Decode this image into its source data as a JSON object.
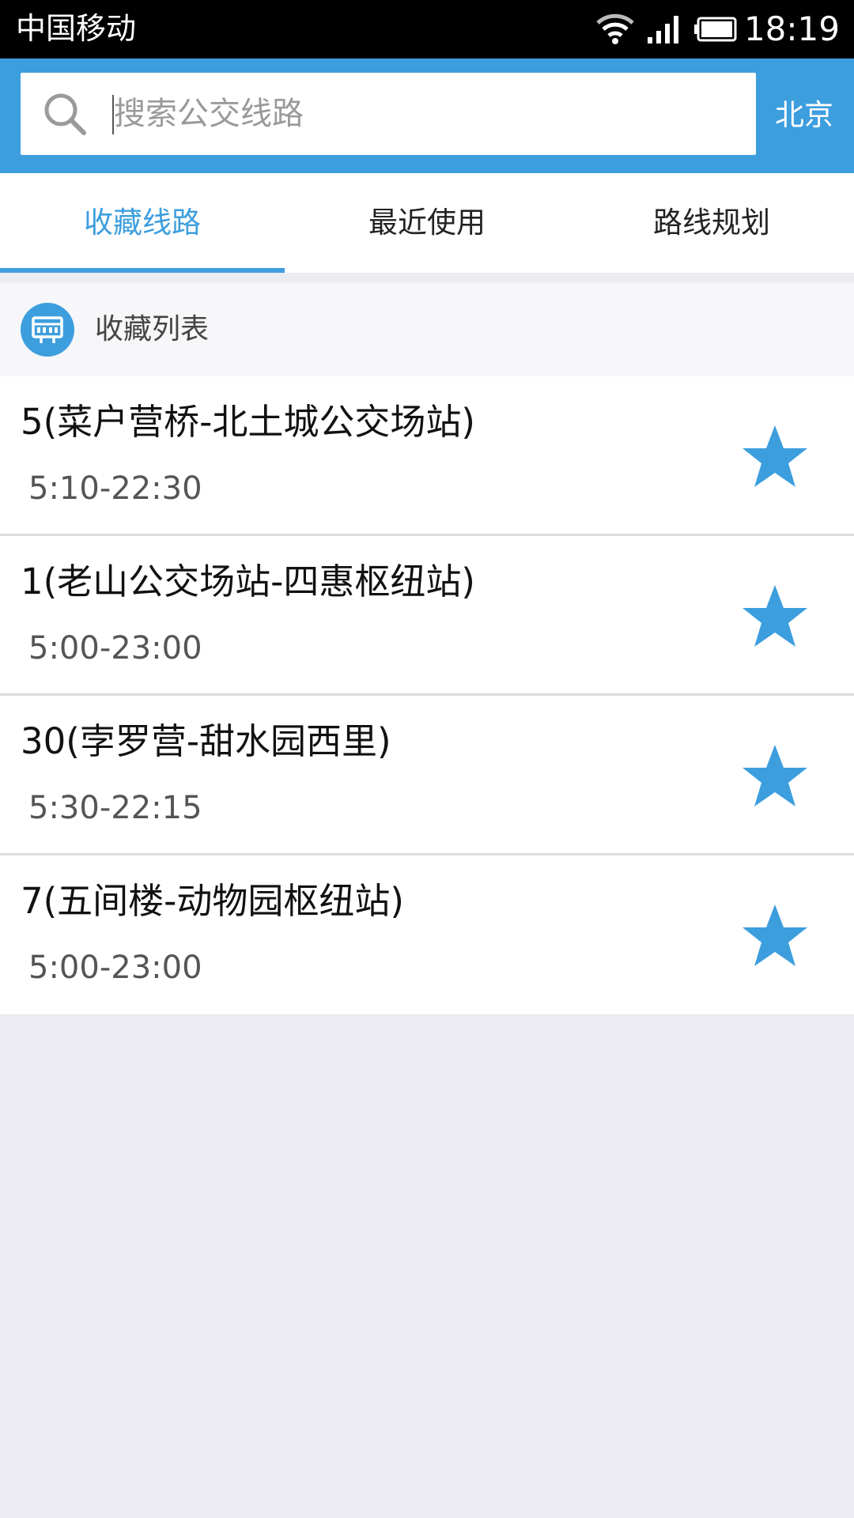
{
  "status_bar": {
    "carrier": "中国移动",
    "time": "18:19"
  },
  "header": {
    "search_placeholder": "搜索公交线路",
    "city": "北京",
    "accent_color": "#3d9ede"
  },
  "tabs": [
    {
      "label": "收藏线路",
      "active": true
    },
    {
      "label": "最近使用",
      "active": false
    },
    {
      "label": "路线规划",
      "active": false
    }
  ],
  "section": {
    "title": "收藏列表",
    "icon": "bus-stop-icon"
  },
  "routes": [
    {
      "name": "5(菜户营桥-北土城公交场站)",
      "hours": "5:10-22:30",
      "favorited": true
    },
    {
      "name": "1(老山公交场站-四惠枢纽站)",
      "hours": "5:00-23:00",
      "favorited": true
    },
    {
      "name": "30(孛罗营-甜水园西里)",
      "hours": "5:30-22:15",
      "favorited": true
    },
    {
      "name": "7(五间楼-动物园枢纽站)",
      "hours": "5:00-23:00",
      "favorited": true
    }
  ]
}
